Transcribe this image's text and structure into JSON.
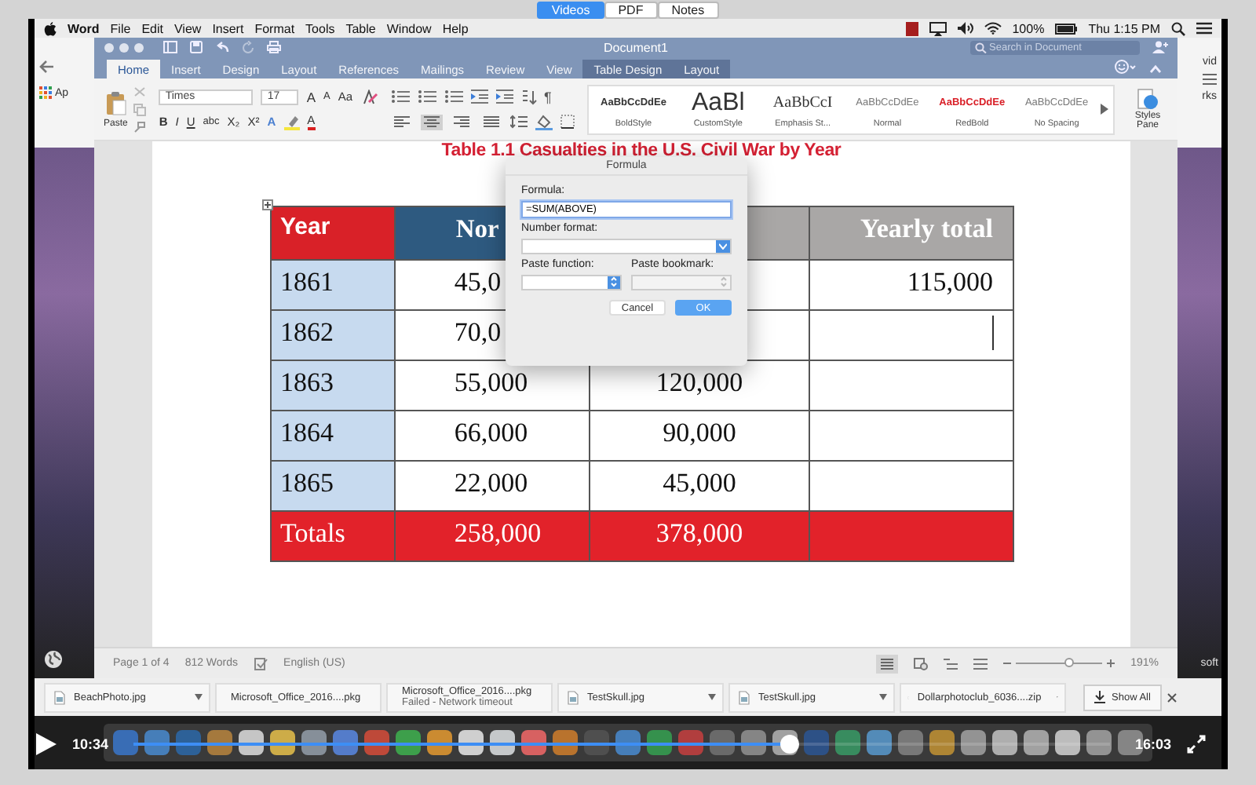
{
  "viewer_tabs": [
    {
      "label": "Videos",
      "selected": true
    },
    {
      "label": "PDF",
      "selected": false
    },
    {
      "label": "Notes",
      "selected": false
    }
  ],
  "menu_bar": {
    "app": "Word",
    "items": [
      "File",
      "Edit",
      "View",
      "Insert",
      "Format",
      "Tools",
      "Table",
      "Window",
      "Help"
    ],
    "battery": "100%",
    "clock": "Thu 1:15 PM"
  },
  "background_window": {
    "left_label": "Ap",
    "right_top": "vid",
    "right_middle": "rks",
    "right_bottom": "soft"
  },
  "word": {
    "title": "Document1",
    "search": {
      "placeholder": "Search in Document"
    },
    "tabs": [
      {
        "label": "Home",
        "selected": true,
        "kind": "main"
      },
      {
        "label": "Insert",
        "selected": false,
        "kind": "main"
      },
      {
        "label": "Design",
        "selected": false,
        "kind": "main"
      },
      {
        "label": "Layout",
        "selected": false,
        "kind": "main"
      },
      {
        "label": "References",
        "selected": false,
        "kind": "main"
      },
      {
        "label": "Mailings",
        "selected": false,
        "kind": "main"
      },
      {
        "label": "Review",
        "selected": false,
        "kind": "main"
      },
      {
        "label": "View",
        "selected": false,
        "kind": "main"
      },
      {
        "label": "Table Design",
        "selected": false,
        "kind": "contextual"
      },
      {
        "label": "Layout",
        "selected": false,
        "kind": "contextual"
      }
    ],
    "ribbon": {
      "paste": "Paste",
      "font": "Times",
      "size": "17",
      "size_buttons": [
        "A",
        "A"
      ],
      "case_button": "Aa",
      "format_buttons": [
        "B",
        "I",
        "U",
        "abc",
        "X₂",
        "X²"
      ],
      "effect_button": "A",
      "color_button": "A",
      "pilcrow": "¶",
      "alignments": [
        {
          "kind": "left",
          "selected": false
        },
        {
          "kind": "center",
          "selected": true
        },
        {
          "kind": "right",
          "selected": false
        },
        {
          "kind": "justify",
          "selected": false
        }
      ],
      "styles": [
        {
          "preview": "AaBbCcDdEe",
          "name": "BoldStyle",
          "kind": "bold"
        },
        {
          "preview": "AaBl",
          "name": "CustomStyle",
          "kind": "large"
        },
        {
          "preview": "AaBbCcI",
          "name": "Emphasis St...",
          "kind": "serif"
        },
        {
          "preview": "AaBbCcDdEe",
          "name": "Normal",
          "kind": "plain"
        },
        {
          "preview": "AaBbCcDdEe",
          "name": "RedBold",
          "kind": "red"
        },
        {
          "preview": "AaBbCcDdEe",
          "name": "No Spacing",
          "kind": "plain"
        }
      ],
      "styles_pane": "Styles Pane"
    },
    "status_bar": {
      "page": "Page 1 of 4",
      "words": "812 Words",
      "language": "English (US)",
      "zoom_slider": {
        "level": 0.62
      },
      "zoom": "191%"
    }
  },
  "document": {
    "title": "Table 1.1 Casualties in the U.S. Civil War by Year",
    "table": {
      "header": [
        {
          "text": "Year",
          "color": "#d92128"
        },
        {
          "text": "Nor",
          "color": "#2e5a80"
        },
        {
          "color": "#a9a7a6"
        },
        {
          "text": "Yearly total",
          "color": "#a9a7a6"
        }
      ],
      "rows": [
        {
          "kind": "data",
          "cursor": false,
          "cells": [
            {
              "text": "1861"
            },
            {
              "text": "45,0"
            },
            {},
            {
              "text": "115,000"
            }
          ]
        },
        {
          "kind": "data",
          "cursor": true,
          "cells": [
            {
              "text": "1862"
            },
            {
              "text": "70,0"
            },
            {},
            {}
          ]
        },
        {
          "kind": "data",
          "cursor": false,
          "cells": [
            {
              "text": "1863"
            },
            {
              "text": "55,000"
            },
            {
              "text": "120,000"
            },
            {}
          ]
        },
        {
          "kind": "data",
          "cursor": false,
          "cells": [
            {
              "text": "1864"
            },
            {
              "text": "66,000"
            },
            {
              "text": "90,000"
            },
            {}
          ]
        },
        {
          "kind": "data",
          "cursor": false,
          "cells": [
            {
              "text": "1865"
            },
            {
              "text": "22,000"
            },
            {
              "text": "45,000"
            },
            {}
          ]
        },
        {
          "kind": "total",
          "cursor": false,
          "cells": [
            {
              "text": "Totals"
            },
            {
              "text": "258,000"
            },
            {
              "text": "378,000"
            },
            {}
          ]
        }
      ]
    }
  },
  "formula_dialog": {
    "title": "Formula",
    "formula_label": "Formula:",
    "formula_value": "=SUM(ABOVE)",
    "number_format_label": "Number format:",
    "paste_function": {
      "label": "Paste function:",
      "disabled": false
    },
    "paste_bookmark": {
      "label": "Paste bookmark:",
      "disabled": true
    },
    "buttons": [
      {
        "label": "Cancel",
        "kind": "secondary"
      },
      {
        "label": "OK",
        "kind": "primary"
      }
    ]
  },
  "downloads": {
    "items": [
      {
        "kind": "image",
        "name": "BeachPhoto.jpg"
      },
      {
        "kind": "package",
        "name": "Microsoft_Office_2016....pkg"
      },
      {
        "kind": "package",
        "name": "Microsoft_Office_2016....pkg",
        "status": "Failed - Network timeout"
      },
      {
        "kind": "image",
        "name": "TestSkull.jpg"
      },
      {
        "kind": "image",
        "name": "TestSkull.jpg"
      },
      {
        "kind": "archive",
        "name": "Dollarphotoclub_6036....zip"
      }
    ],
    "show_all": "Show All"
  },
  "player": {
    "elapsed": "10:34",
    "total": "16:03",
    "level": 0.66
  }
}
